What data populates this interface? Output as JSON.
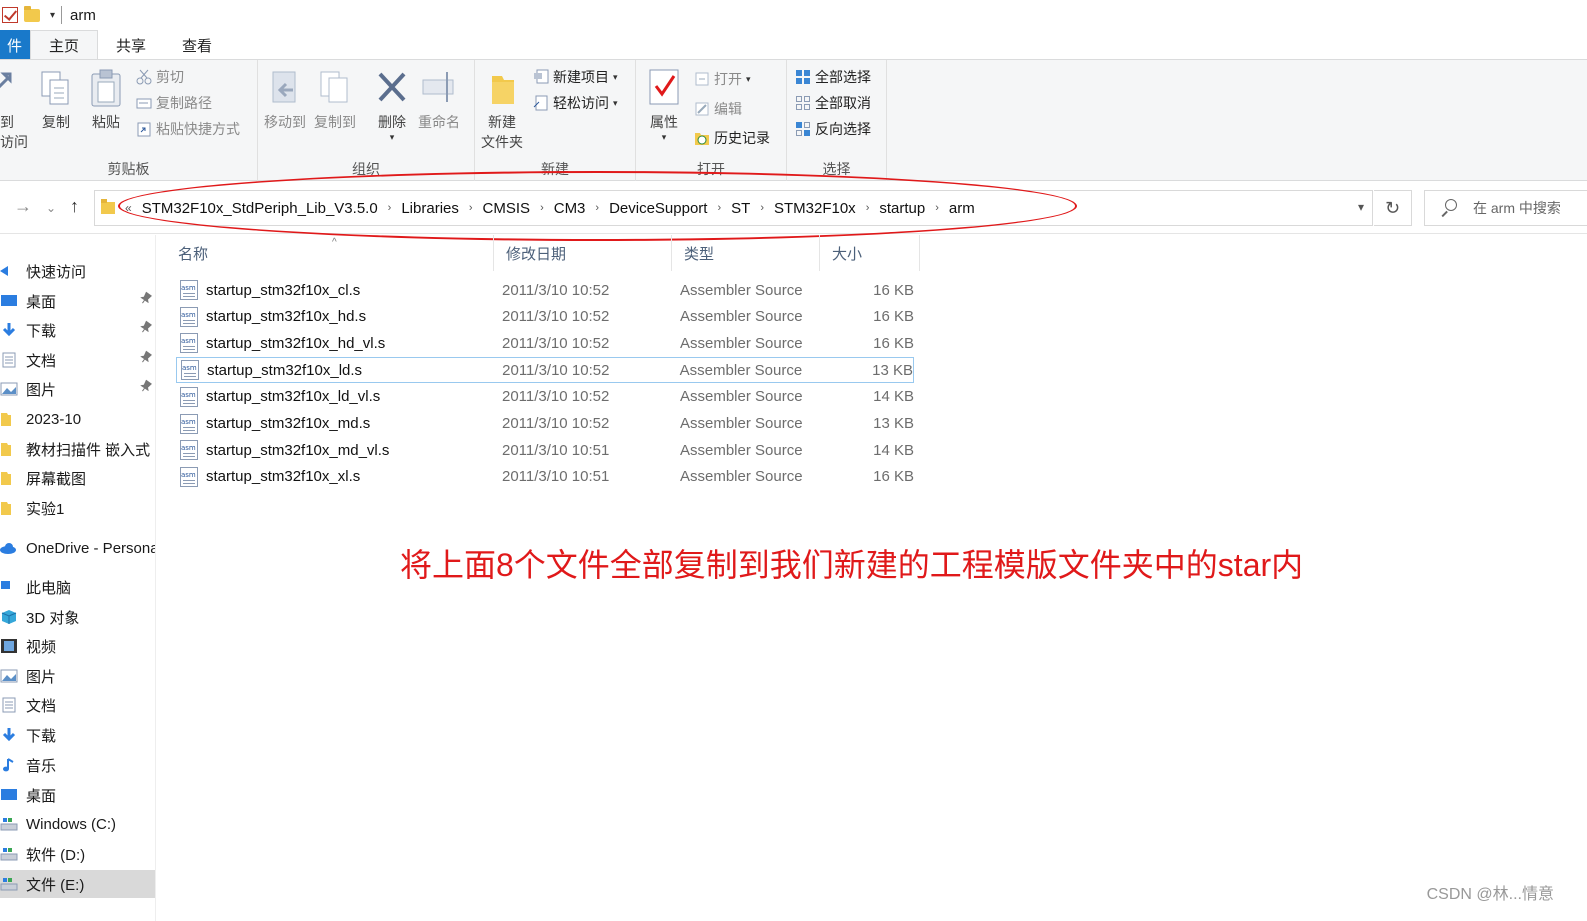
{
  "window": {
    "title": "arm"
  },
  "ribbon_tabs": [
    {
      "label": "件"
    },
    {
      "label": "主页"
    },
    {
      "label": "共享"
    },
    {
      "label": "查看"
    }
  ],
  "ribbon": {
    "clipboard": {
      "label": "剪贴板",
      "pin_to_quick_access": "到\n访问",
      "copy": "复制",
      "paste": "粘贴",
      "cut": "剪切",
      "copy_path": "复制路径",
      "paste_shortcut": "粘贴快捷方式"
    },
    "organize": {
      "label": "组织",
      "move_to": "移动到",
      "copy_to": "复制到",
      "delete": "删除",
      "rename": "重命名"
    },
    "new": {
      "label": "新建",
      "new_folder": "新建\n文件夹",
      "new_item": "新建项目",
      "easy_access": "轻松访问"
    },
    "open": {
      "label": "打开",
      "properties": "属性",
      "open": "打开",
      "edit": "编辑",
      "history": "历史记录"
    },
    "select": {
      "label": "选择",
      "select_all": "全部选择",
      "select_none": "全部取消",
      "invert": "反向选择"
    }
  },
  "address": {
    "overflow": "«",
    "breadcrumbs": [
      "STM32F10x_StdPeriph_Lib_V3.5.0",
      "Libraries",
      "CMSIS",
      "CM3",
      "DeviceSupport",
      "ST",
      "STM32F10x",
      "startup",
      "arm"
    ],
    "separator": "›"
  },
  "search": {
    "placeholder": "在 arm 中搜索"
  },
  "sidebar": {
    "items": [
      {
        "label": "快速访问",
        "icon": "star-icon",
        "pinned": false
      },
      {
        "label": "桌面",
        "icon": "desktop-icon",
        "pinned": true
      },
      {
        "label": "下载",
        "icon": "download-icon",
        "pinned": true
      },
      {
        "label": "文档",
        "icon": "document-icon",
        "pinned": true
      },
      {
        "label": "图片",
        "icon": "pictures-icon",
        "pinned": true
      },
      {
        "label": "2023-10",
        "icon": "folder-icon",
        "pinned": false
      },
      {
        "label": "教材扫描件 嵌入式",
        "icon": "folder-icon",
        "pinned": false
      },
      {
        "label": "屏幕截图",
        "icon": "folder-icon",
        "pinned": false
      },
      {
        "label": "实验1",
        "icon": "folder-icon",
        "pinned": false
      },
      {
        "label": "OneDrive - Persona",
        "icon": "cloud-icon",
        "pinned": false
      },
      {
        "label": "此电脑",
        "icon": "computer-icon",
        "pinned": false
      },
      {
        "label": "3D 对象",
        "icon": "cube-icon",
        "pinned": false
      },
      {
        "label": "视频",
        "icon": "video-icon",
        "pinned": false
      },
      {
        "label": "图片",
        "icon": "pictures-icon",
        "pinned": false
      },
      {
        "label": "文档",
        "icon": "document-icon",
        "pinned": false
      },
      {
        "label": "下载",
        "icon": "download-icon",
        "pinned": false
      },
      {
        "label": "音乐",
        "icon": "music-icon",
        "pinned": false
      },
      {
        "label": "桌面",
        "icon": "desktop-icon",
        "pinned": false
      },
      {
        "label": "Windows (C:)",
        "icon": "drive-icon",
        "pinned": false
      },
      {
        "label": "软件 (D:)",
        "icon": "drive-icon",
        "pinned": false
      },
      {
        "label": "文件 (E:)",
        "icon": "drive-icon",
        "pinned": false,
        "selected": true
      }
    ]
  },
  "columns": {
    "name": "名称",
    "date": "修改日期",
    "type": "类型",
    "size": "大小"
  },
  "files": [
    {
      "name": "startup_stm32f10x_cl.s",
      "date": "2011/3/10 10:52",
      "type": "Assembler Source",
      "size": "16 KB"
    },
    {
      "name": "startup_stm32f10x_hd.s",
      "date": "2011/3/10 10:52",
      "type": "Assembler Source",
      "size": "16 KB"
    },
    {
      "name": "startup_stm32f10x_hd_vl.s",
      "date": "2011/3/10 10:52",
      "type": "Assembler Source",
      "size": "16 KB"
    },
    {
      "name": "startup_stm32f10x_ld.s",
      "date": "2011/3/10 10:52",
      "type": "Assembler Source",
      "size": "13 KB"
    },
    {
      "name": "startup_stm32f10x_ld_vl.s",
      "date": "2011/3/10 10:52",
      "type": "Assembler Source",
      "size": "14 KB"
    },
    {
      "name": "startup_stm32f10x_md.s",
      "date": "2011/3/10 10:52",
      "type": "Assembler Source",
      "size": "13 KB"
    },
    {
      "name": "startup_stm32f10x_md_vl.s",
      "date": "2011/3/10 10:51",
      "type": "Assembler Source",
      "size": "14 KB"
    },
    {
      "name": "startup_stm32f10x_xl.s",
      "date": "2011/3/10 10:51",
      "type": "Assembler Source",
      "size": "16 KB"
    }
  ],
  "annotation": "将上面8个文件全部复制到我们新建的工程模版文件夹中的star内",
  "watermark": "CSDN @林...情意",
  "colors": {
    "accent": "#1979ca",
    "annotation_red": "#e0191a",
    "selection": "#99c9ef"
  }
}
